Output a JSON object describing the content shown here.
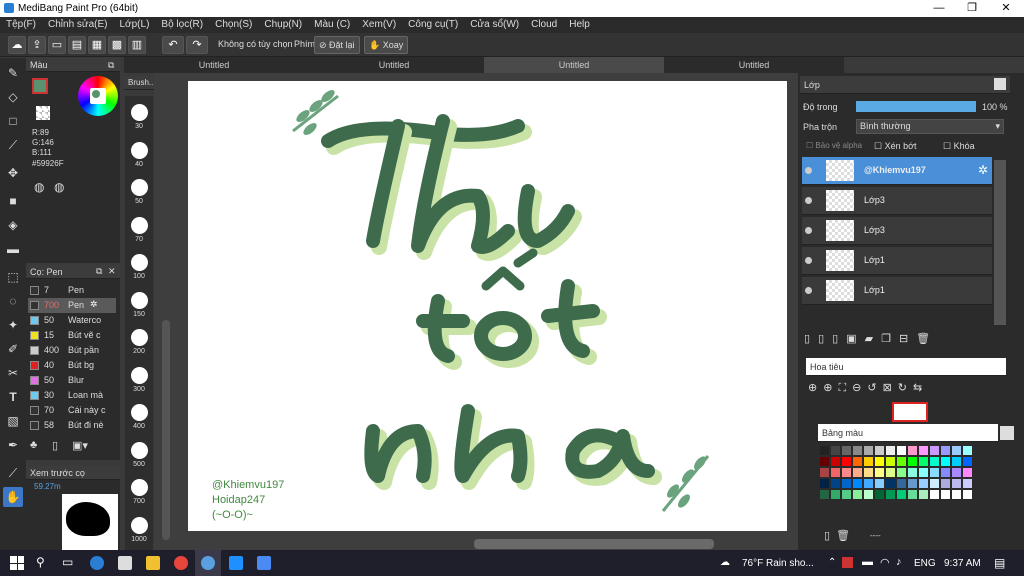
{
  "window": {
    "title": "MediBang Paint Pro (64bit)",
    "min": "—",
    "max": "❐",
    "close": "✕"
  },
  "menu": [
    "Tệp(F)",
    "Chỉnh sửa(E)",
    "Lớp(L)",
    "Bộ lọc(R)",
    "Chọn(S)",
    "Chụp(N)",
    "Màu (C)",
    "Xem(V)",
    "Công cụ(T)",
    "Cửa sổ(W)",
    "Cloud",
    "Help"
  ],
  "toolbar": {
    "no_selection": "Không có tùy chọn",
    "key_label": "Phím",
    "reset": "Đặt lại",
    "rotate": "Xoay"
  },
  "color_panel": {
    "title": "Màu",
    "r": "R:89",
    "g": "G:146",
    "b": "B:111",
    "hex": "#59926F",
    "fg_color": "#59926F"
  },
  "brush_panel": {
    "title": "Cọ: Pen",
    "items": [
      {
        "size": "7",
        "name": "Pen",
        "color": "#333333"
      },
      {
        "size": "700",
        "name": "Pen",
        "color": "#333333"
      },
      {
        "size": "50",
        "name": "Waterco",
        "color": "#6ec8f0"
      },
      {
        "size": "15",
        "name": "Bút vẽ c",
        "color": "#f0e020"
      },
      {
        "size": "400",
        "name": "Bút pần",
        "color": "#cccccc"
      },
      {
        "size": "40",
        "name": "Bút bg",
        "color": "#e02020"
      },
      {
        "size": "50",
        "name": "Blur",
        "color": "#e070e0"
      },
      {
        "size": "30",
        "name": "Loan mà",
        "color": "#6ec8f0"
      },
      {
        "size": "70",
        "name": "Cái này c",
        "color": "#333333"
      },
      {
        "size": "58",
        "name": "Bút đi nè",
        "color": "#333333"
      }
    ]
  },
  "preview_panel": {
    "title": "Xem trước cọ",
    "value": "59.27m"
  },
  "size_panel": {
    "title": "Brush...",
    "sizes": [
      "30",
      "40",
      "50",
      "70",
      "100",
      "150",
      "200",
      "300",
      "400",
      "500",
      "700",
      "1000"
    ]
  },
  "tabs": [
    "Untitled",
    "Untitled",
    "Untitled",
    "Untitled"
  ],
  "canvas": {
    "line1": "Thi",
    "line2": "tốt",
    "line3": "nha",
    "credit1": "@Khiemvu197",
    "credit2": "Hoidap247",
    "credit3": "(~O-O)~"
  },
  "layer_panel": {
    "title": "Lớp",
    "opacity_label": "Độ trong",
    "opacity_value": "100 %",
    "opacity": 100,
    "blend_label": "Pha trộn",
    "blend_value": "Bình thường",
    "protect_alpha": "Bảo vệ alpha",
    "clipping": "Xén bớt",
    "lock": "Khóa",
    "layers": [
      "@Khiemvu197",
      "Lớp3",
      "Lớp3",
      "Lớp1",
      "Lớp1"
    ]
  },
  "navigator": {
    "title": "Hoa tiêu"
  },
  "palette": {
    "title": "Bảng màu",
    "footer": "----"
  },
  "taskbar": {
    "weather": "76°F  Rain sho...",
    "lang": "ENG",
    "time": "9:37 AM"
  }
}
